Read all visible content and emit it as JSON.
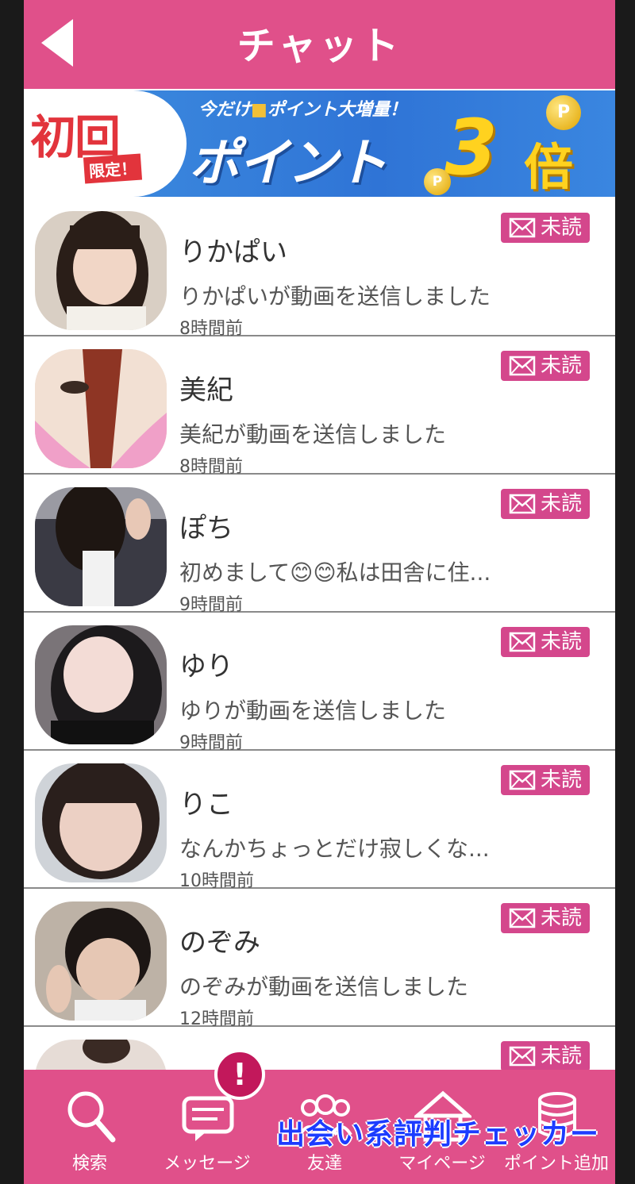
{
  "header": {
    "title": "チャット"
  },
  "banner": {
    "first_time": "初回",
    "limited": "限定！",
    "subtitle": "今だけ",
    "subtitle_rest": "ポイント大増量！",
    "main": "ポイント",
    "multiplier": "3",
    "times": "倍",
    "coin_label": "P"
  },
  "unread_label": "未読",
  "chats": [
    {
      "name": "りかぱい",
      "preview": "りかぱいが動画を送信しました",
      "time": "8時間前"
    },
    {
      "name": "美紀",
      "preview": "美紀が動画を送信しました",
      "time": "8時間前"
    },
    {
      "name": "ぽち",
      "preview": "初めまして😊😊私は田舎に住...",
      "time": "9時間前"
    },
    {
      "name": "ゆり",
      "preview": "ゆりが動画を送信しました",
      "time": "9時間前"
    },
    {
      "name": "りこ",
      "preview": "なんかちょっとだけ寂しくな...",
      "time": "10時間前"
    },
    {
      "name": "のぞみ",
      "preview": "のぞみが動画を送信しました",
      "time": "12時間前"
    }
  ],
  "nav": {
    "search": "検索",
    "messages": "メッセージ",
    "friends": "友達",
    "home": "マイページ",
    "points": "ポイント追加",
    "alert": "!"
  },
  "watermark": "出会い系評判チェッカー",
  "colors": {
    "header_pink": "#e0508a",
    "badge_pink": "#d4478c",
    "banner_blue": "#2f74d6",
    "watermark_blue": "#1c3cff"
  }
}
